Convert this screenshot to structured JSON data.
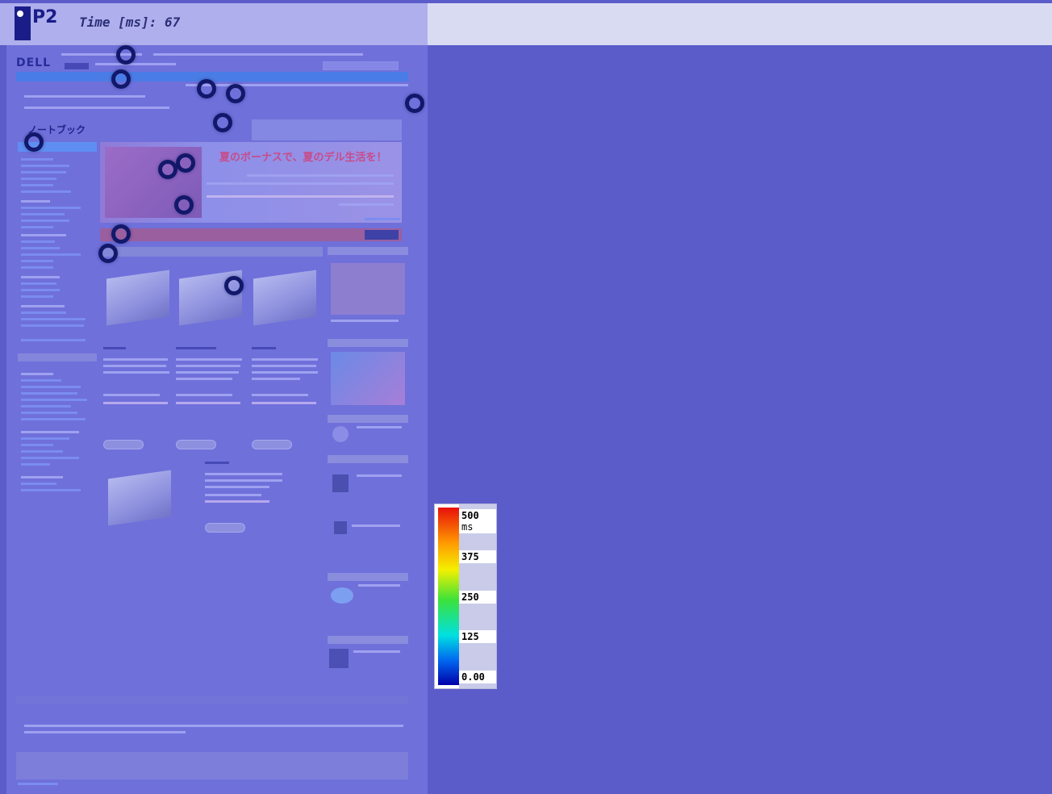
{
  "header": {
    "logo_text": "P2",
    "time_label": "Time [ms]: 67"
  },
  "webpage": {
    "brand": "DELL",
    "section_title": "ノートブック",
    "hero_title": "夏のボーナスで、夏のデル生活を！"
  },
  "legend": {
    "max": "500",
    "unit": "ms",
    "v375": "375",
    "v250": "250",
    "v125": "125",
    "min": "0.00",
    "colors": [
      "#e8100a",
      "#ff9a00",
      "#f4f000",
      "#3ce23a",
      "#00e0e0",
      "#0068f0",
      "#0000a8"
    ]
  },
  "overlay_color": "#5b5cc9",
  "gaze_marker_color": "#12186a"
}
